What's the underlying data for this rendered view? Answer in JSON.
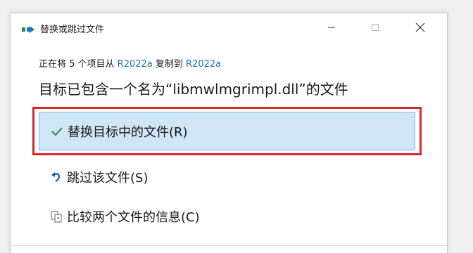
{
  "window": {
    "title": "替换或跳过文件",
    "controls": {
      "minimize": "–",
      "maximize": "☐",
      "close": "✕"
    }
  },
  "info": {
    "prefix": "正在将 5 个项目从 ",
    "source": "R2022a",
    "middle": " 复制到 ",
    "destination": "R2022a"
  },
  "headline": "目标已包含一个名为“libmwlmgrimpl.dll”的文件",
  "options": {
    "replace": "替换目标中的文件(R)",
    "skip": "跳过该文件(S)",
    "compare": "比较两个文件的信息(C)"
  },
  "icons": {
    "app": "copy-arrow-icon",
    "replace": "checkmark-icon",
    "skip": "undo-arrow-icon",
    "compare": "compare-files-icon"
  },
  "colors": {
    "accent_link": "#1a73c2",
    "selected_bg": "#cfe5f8",
    "highlight_frame": "#d9262e",
    "check_green": "#2e8b3e"
  }
}
